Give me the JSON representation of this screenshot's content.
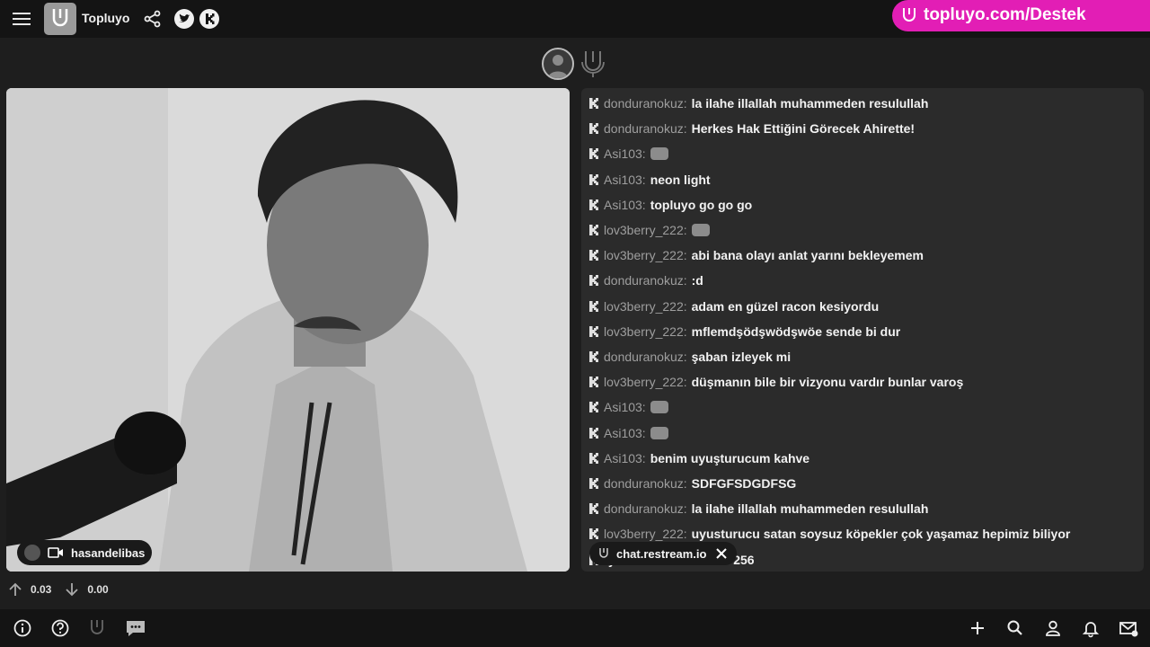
{
  "header": {
    "app_title": "Topluyo",
    "promo_text": "topluyo.com/Destek",
    "icons": [
      "menu-icon",
      "topluyo-logo",
      "share-icon",
      "twitter-icon",
      "kick-icon"
    ]
  },
  "stream": {
    "streamer_name": "hasandelibas"
  },
  "chat": {
    "messages": [
      {
        "user": "donduranokuz:",
        "text": "la ilahe illallah muhammeden resulullah"
      },
      {
        "user": "donduranokuz:",
        "text": "Herkes Hak Ettiğini Görecek Ahirette!"
      },
      {
        "user": "Asi103:",
        "text": "",
        "emote": true
      },
      {
        "user": "Asi103:",
        "text": "neon light"
      },
      {
        "user": "Asi103:",
        "text": "topluyo go go go"
      },
      {
        "user": "lov3berry_222:",
        "text": "",
        "emote": true
      },
      {
        "user": "lov3berry_222:",
        "text": "abi bana olayı anlat yarını bekleyemem"
      },
      {
        "user": "donduranokuz:",
        "text": ":d"
      },
      {
        "user": "lov3berry_222:",
        "text": "adam en güzel racon kesiyordu"
      },
      {
        "user": "lov3berry_222:",
        "text": "mflemdşödşwödşwöe sende bi dur"
      },
      {
        "user": "donduranokuz:",
        "text": "şaban izleyek mi"
      },
      {
        "user": "lov3berry_222:",
        "text": "düşmanın bile bir vizyonu vardır bunlar varoş"
      },
      {
        "user": "Asi103:",
        "text": "",
        "emote": true
      },
      {
        "user": "Asi103:",
        "text": "",
        "emote": true
      },
      {
        "user": "Asi103:",
        "text": "benim uyuşturucum kahve"
      },
      {
        "user": "donduranokuz:",
        "text": "SDFGFSDGDFSG"
      },
      {
        "user": "donduranokuz:",
        "text": "la ilahe illallah muhammeden resulullah"
      },
      {
        "user": "lov3berry_222:",
        "text": "uyusturucu satan soysuz köpekler çok yaşamaz hepimiz biliyor"
      },
      {
        "user": "",
        "text": "yerine oturdu bölüm 256"
      }
    ],
    "source_label": "chat.restream.io"
  },
  "stats": {
    "upload": "0.03",
    "download": "0.00"
  },
  "footer": {
    "icons": [
      "info-icon",
      "help-icon",
      "topluyo-icon",
      "chat-icon",
      "add-icon",
      "search-icon",
      "user-icon",
      "bell-icon",
      "mail-icon"
    ]
  },
  "colors": {
    "accent": "#e21eb5",
    "bar_bg": "#141414",
    "page_bg": "#1e1e1e",
    "chat_bg": "#2b2b2b"
  }
}
